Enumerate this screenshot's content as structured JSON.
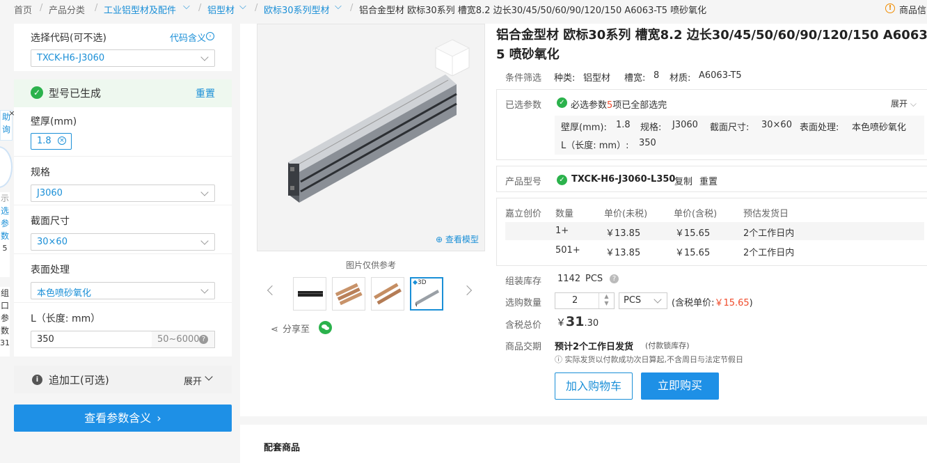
{
  "breadcrumb": {
    "home": "首页",
    "category": "产品分类",
    "l1": "工业铝型材及配件",
    "l2": "铝型材",
    "l3": "欧标30系列型材",
    "current": "铝合金型材 欧标30系列 槽宽8.2 边长30/45/50/60/90/120/150 A6063-T5 喷砂氧化",
    "notice": "商品信"
  },
  "left_panel": {
    "code_label": "选择代码(可不选)",
    "code_help": "代码含义",
    "code_value": "TXCK-H6-J3060",
    "status": "型号已生成",
    "reset": "重置",
    "wall_label": "壁厚(mm)",
    "wall_value": "1.8",
    "spec_label": "规格",
    "spec_value": "J3060",
    "section_label": "截面尺寸",
    "section_value": "30×60",
    "surface_label": "表面处理",
    "surface_value": "本色喷砂氧化",
    "length_label": "L（长度: mm）",
    "length_value": "350",
    "length_range": "50~6000",
    "extra_label": "追加工(可选)",
    "expand": "展开",
    "view_params": "查看参数含义"
  },
  "edge_widget": {
    "top_chars": [
      "助",
      "询"
    ],
    "mid_chars": [
      "示",
      "选",
      "参",
      "数"
    ],
    "num1": "5",
    "bot_chars": [
      "组",
      "口",
      "参",
      "数"
    ],
    "num2": "31"
  },
  "gallery": {
    "view_model": "查看模型",
    "note": "图片仅供参考",
    "badge_3d": "3D",
    "share": "分享至"
  },
  "product": {
    "title_line1": "铝合金型材 欧标30系列 槽宽8.2 边长30/45/50/60/90/120/150 A6063-T",
    "title_line2": "5 喷砂氧化",
    "filter_label": "条件筛选",
    "filter_type_label": "种类:",
    "filter_type": "铝型材",
    "filter_slot_label": "槽宽:",
    "filter_slot": "8",
    "filter_mat_label": "材质:",
    "filter_mat": "A6063-T5",
    "selected_label": "已选参数",
    "selected_pre": "必选参数",
    "selected_count": "5",
    "selected_post": "项已全部选完",
    "expand": "展开",
    "p_wall_label": "壁厚(mm):",
    "p_wall": "1.8",
    "p_spec_label": "规格:",
    "p_spec": "J3060",
    "p_section_label": "截面尺寸:",
    "p_section": "30×60",
    "p_surface_label": "表面处理:",
    "p_surface": "本色喷砂氧化",
    "p_len_label": "L（长度: mm）:",
    "p_len": "350",
    "model_label": "产品型号",
    "model_no": "TXCK-H6-J3060-L350",
    "copy": "复制",
    "reset": "重置"
  },
  "price_table": {
    "brand": "嘉立创价",
    "headers": [
      "数量",
      "单价(未税)",
      "单价(含税)",
      "预估发货日"
    ],
    "rows": [
      {
        "qty": "1+",
        "net": "￥13.85",
        "gross": "￥15.65",
        "ship": "2个工作日内"
      },
      {
        "qty": "501+",
        "net": "￥13.85",
        "gross": "￥15.65",
        "ship": "2个工作日内"
      }
    ]
  },
  "order": {
    "stock_label": "组装库存",
    "stock": "1142",
    "stock_unit": "PCS",
    "qty_label": "选购数量",
    "qty": "2",
    "unit": "PCS",
    "unit_price_pre": "(含税单价:",
    "unit_price": "￥15.65",
    "unit_price_post": ")",
    "total_label": "含税总价",
    "total_cur": "￥",
    "total_int": "31",
    "total_dec": ".30",
    "delivery_label": "商品交期",
    "delivery": "预计2个工作日发货",
    "delivery_note": "(付款锁库存)",
    "delivery_tip": "实际发货以付款成功次日算起,不含周日与法定节假日",
    "add_cart": "加入购物车",
    "buy_now": "立即购买"
  },
  "related": {
    "title": "配套商品"
  },
  "colors": {
    "accent": "#1a8fd7",
    "price": "#f04a2a",
    "success": "#2bb24c"
  }
}
